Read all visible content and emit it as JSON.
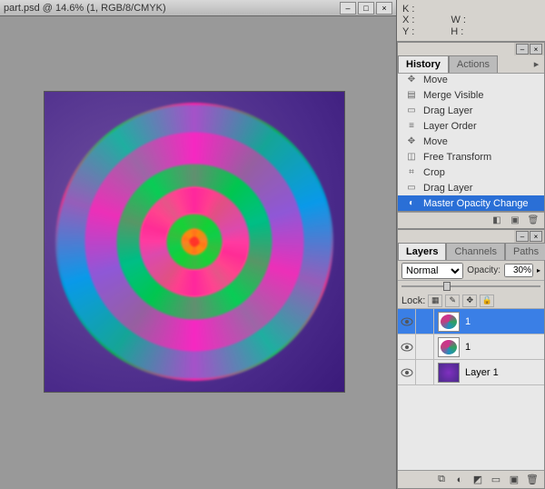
{
  "document": {
    "title": "part.psd @ 14.6% (1, RGB/8/CMYK)"
  },
  "info": {
    "k_label": "K :",
    "x_label": "X :",
    "y_label": "Y :",
    "w_label": "W :",
    "h_label": "H :"
  },
  "history": {
    "tab_label": "History",
    "actions_tab": "Actions",
    "items": [
      {
        "icon": "move",
        "label": "Move"
      },
      {
        "icon": "merge",
        "label": "Merge Visible"
      },
      {
        "icon": "drag",
        "label": "Drag Layer"
      },
      {
        "icon": "order",
        "label": "Layer Order"
      },
      {
        "icon": "move",
        "label": "Move"
      },
      {
        "icon": "transform",
        "label": "Free Transform"
      },
      {
        "icon": "crop",
        "label": "Crop"
      },
      {
        "icon": "drag",
        "label": "Drag Layer"
      },
      {
        "icon": "opacity",
        "label": "Master Opacity Change"
      }
    ],
    "selected": 8
  },
  "layers": {
    "tab_label": "Layers",
    "channels_tab": "Channels",
    "paths_tab": "Paths",
    "blend_modes": [
      "Normal"
    ],
    "blend_selected": "Normal",
    "opacity_label": "Opacity:",
    "opacity_value": "30%",
    "lock_label": "Lock:",
    "items": [
      {
        "name": "1",
        "thumb": "swirl",
        "selected": true
      },
      {
        "name": "1",
        "thumb": "swirl",
        "selected": false
      },
      {
        "name": "Layer 1",
        "thumb": "solid",
        "selected": false
      }
    ]
  }
}
